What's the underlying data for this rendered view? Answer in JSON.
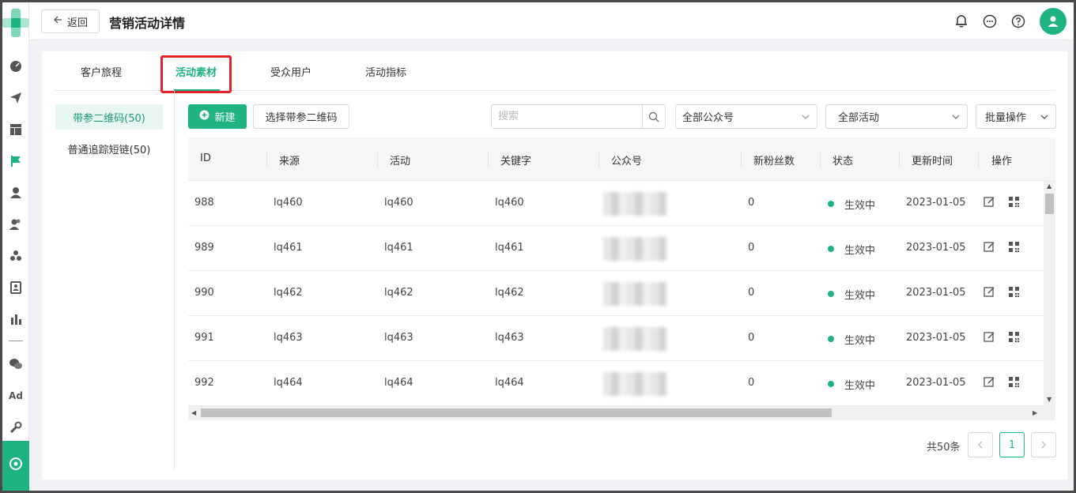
{
  "header": {
    "back_label": "返回",
    "title": "营销活动详情"
  },
  "tabs": [
    {
      "label": "客户旅程"
    },
    {
      "label": "活动素材"
    },
    {
      "label": "受众用户"
    },
    {
      "label": "活动指标"
    }
  ],
  "active_tab": "活动素材",
  "leftnav": [
    {
      "label": "带参二维码(50)"
    },
    {
      "label": "普通追踪短链(50)"
    }
  ],
  "toolbar": {
    "new_label": "新建",
    "select_label": "选择带参二维码",
    "search_placeholder": "搜索",
    "account_filter": "全部公众号",
    "activity_filter": "全部活动",
    "batch_label": "批量操作"
  },
  "table": {
    "columns": [
      "ID",
      "来源",
      "活动",
      "关键字",
      "公众号",
      "新粉丝数",
      "状态",
      "更新时间",
      "操作"
    ],
    "rows": [
      {
        "id": "988",
        "source": "lq460",
        "activity": "lq460",
        "keyword": "lq460",
        "fans": "0",
        "status": "生效中",
        "updated": "2023-01-05"
      },
      {
        "id": "989",
        "source": "lq461",
        "activity": "lq461",
        "keyword": "lq461",
        "fans": "0",
        "status": "生效中",
        "updated": "2023-01-05"
      },
      {
        "id": "990",
        "source": "lq462",
        "activity": "lq462",
        "keyword": "lq462",
        "fans": "0",
        "status": "生效中",
        "updated": "2023-01-05"
      },
      {
        "id": "991",
        "source": "lq463",
        "activity": "lq463",
        "keyword": "lq463",
        "fans": "0",
        "status": "生效中",
        "updated": "2023-01-05"
      },
      {
        "id": "992",
        "source": "lq464",
        "activity": "lq464",
        "keyword": "lq464",
        "fans": "0",
        "status": "生效中",
        "updated": "2023-01-05"
      }
    ]
  },
  "pagination": {
    "total": "共50条",
    "current_page": "1"
  },
  "sidebar_icons": [
    "dashboard-icon",
    "send-icon",
    "layout-icon",
    "flag-icon",
    "user-icon",
    "users-icon",
    "group-icon",
    "contact-card-icon",
    "bar-chart-icon",
    "wechat-icon",
    "ad-icon",
    "wrench-icon",
    "settings-icon"
  ],
  "sidebar_ad_label": "Ad",
  "colors": {
    "accent": "#1fb384",
    "highlight": "#e5232a"
  }
}
